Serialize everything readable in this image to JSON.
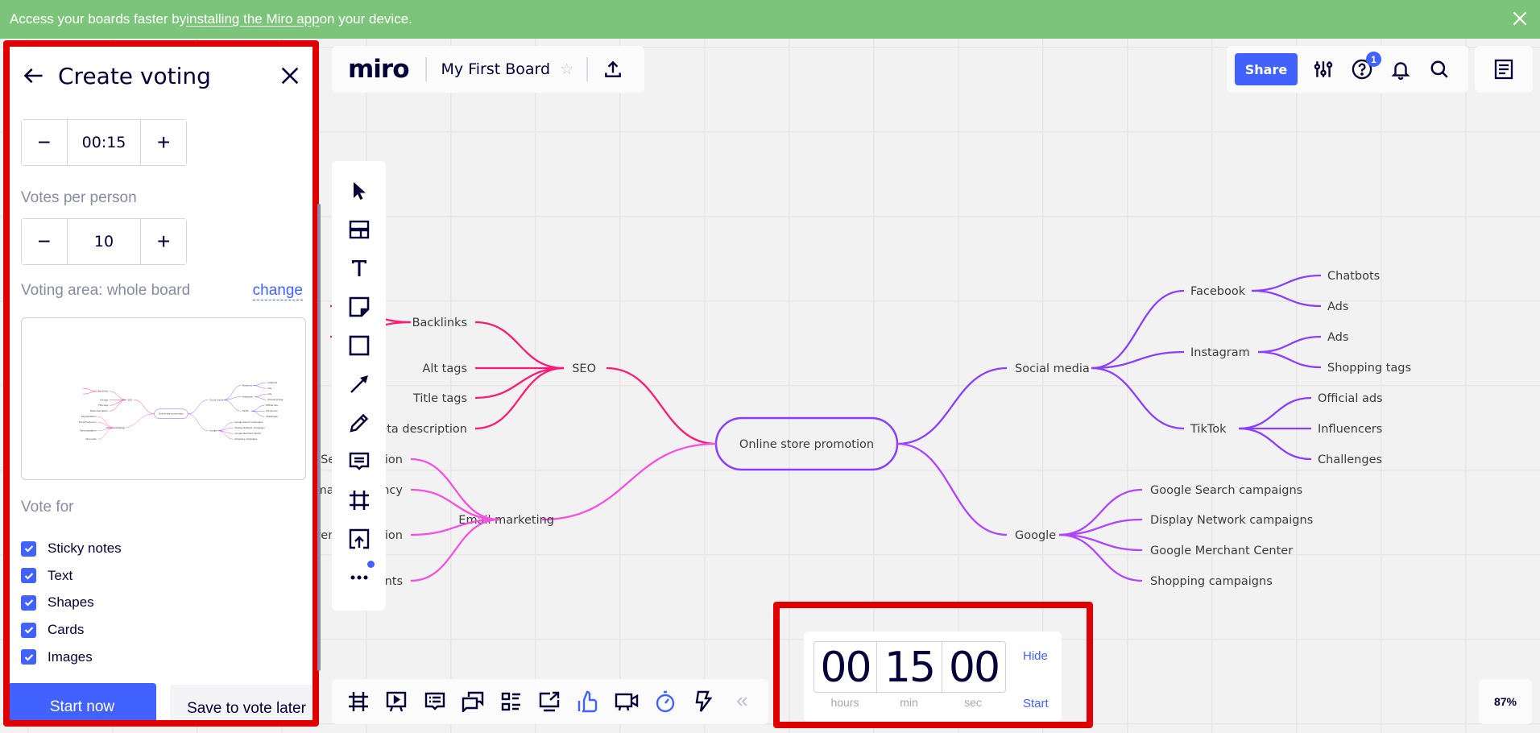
{
  "banner": {
    "text_before": "Access your boards faster by ",
    "link": "installing the Miro app",
    "text_after": " on your device.",
    "close_icon": "close-icon"
  },
  "topbar": {
    "logo": "miro",
    "board_title": "My First Board",
    "star_icon": "star-icon",
    "export_icon": "upload-icon"
  },
  "topright": {
    "share_label": "Share",
    "icons": [
      "settings-sliders-icon",
      "help-icon",
      "bell-icon",
      "search-icon"
    ],
    "help_badge": "1",
    "notes_icon": "notes-icon"
  },
  "toolbar": {
    "tools": [
      "select",
      "templates",
      "text",
      "sticky-note",
      "shape",
      "connection-line",
      "pen",
      "comment",
      "frame",
      "upload",
      "more"
    ]
  },
  "bottombar": {
    "tools": [
      "frames",
      "presentation",
      "comments-list",
      "chat",
      "cards-list",
      "share-screen",
      "voting",
      "video-call",
      "timer",
      "integrations"
    ],
    "active_tools": [
      "voting",
      "timer"
    ],
    "collapse_icon": "double-chevron-left-icon"
  },
  "timer": {
    "hours": "00",
    "minutes": "15",
    "seconds": "00",
    "hours_label": "hours",
    "minutes_label": "min",
    "seconds_label": "sec",
    "hide_label": "Hide",
    "start_label": "Start"
  },
  "zoom": {
    "level": "87%"
  },
  "voting_panel": {
    "title": "Create voting",
    "duration_value": "00:15",
    "votes_label": "Votes per person",
    "votes_value": "10",
    "area_label": "Voting area: whole board",
    "change_label": "change",
    "vote_for_label": "Vote for",
    "options": [
      {
        "label": "Sticky notes",
        "checked": true
      },
      {
        "label": "Text",
        "checked": true
      },
      {
        "label": "Shapes",
        "checked": true
      },
      {
        "label": "Cards",
        "checked": true
      },
      {
        "label": "Images",
        "checked": true
      }
    ],
    "start_label": "Start now",
    "later_label": "Save to vote later"
  },
  "mindmap": {
    "root": "Online store promotion",
    "colors": {
      "seo": "#ff1a75",
      "email": "#f550e0",
      "social": "#8a3ffc",
      "google": "#b044ff",
      "root_border": "#8a3ffc"
    },
    "left": [
      {
        "label": "SEO",
        "children": [
          "Backlinks",
          "Alt tags",
          "Title tags",
          "Meta description"
        ]
      },
      {
        "label": "Email marketing",
        "children": [
          "Segmentation",
          "Email frequency",
          "Personalization",
          "Discounts"
        ]
      }
    ],
    "right": [
      {
        "label": "Social media",
        "children": [
          {
            "label": "Facebook",
            "children": [
              "Chatbots",
              "Ads"
            ]
          },
          {
            "label": "Instagram",
            "children": [
              "Ads",
              "Shopping tags"
            ]
          },
          {
            "label": "TikTok",
            "children": [
              "Official ads",
              "Influencers",
              "Challenges"
            ]
          }
        ]
      },
      {
        "label": "Google",
        "children": [
          "Google Search campaigns",
          "Display Network campaigns",
          "Google Merchant Center",
          "Shopping campaigns"
        ]
      }
    ]
  }
}
